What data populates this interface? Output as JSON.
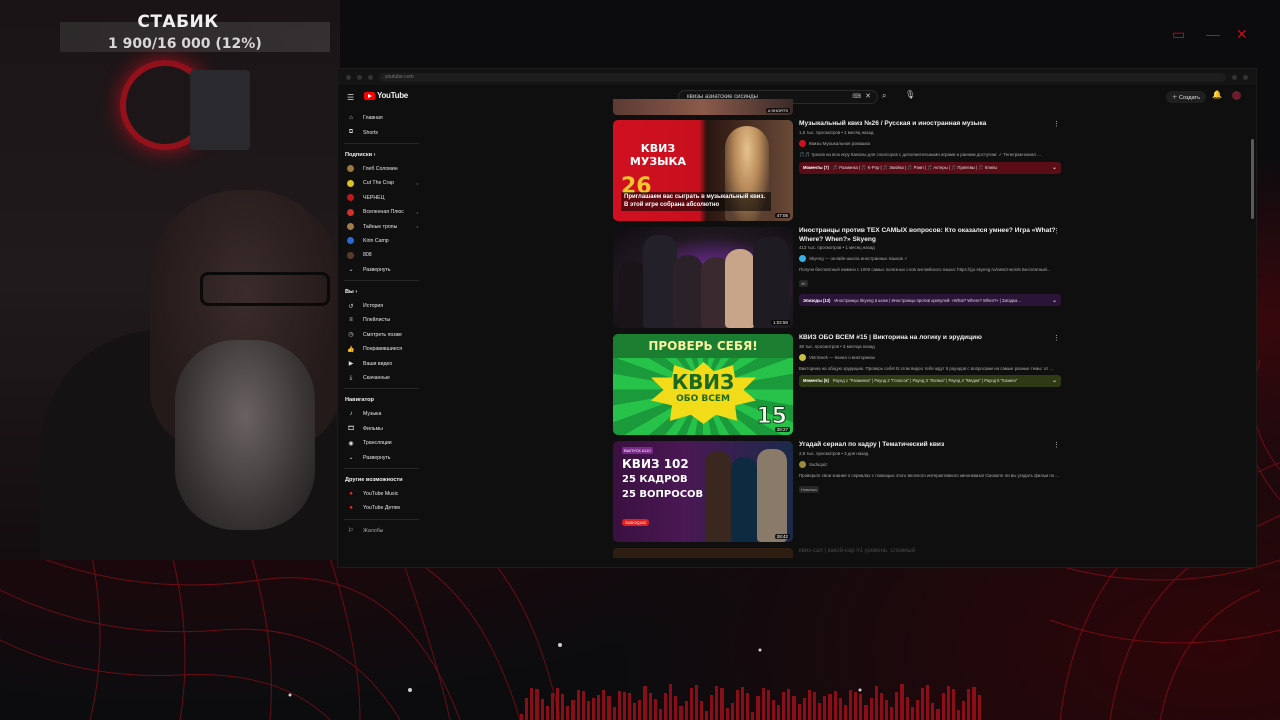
{
  "overlay": {
    "stat_title": "СТАБИК",
    "stat_value": "1 900/16 000 (12%)"
  },
  "browser": {
    "url": "youtube.com"
  },
  "youtube": {
    "logo": "YouTube",
    "search_query": "квизы азиатские сисинды",
    "create_label": "Создать"
  },
  "sidebar": {
    "main": [
      {
        "label": "Главная",
        "icon": "home-icon"
      },
      {
        "label": "Shorts",
        "icon": "shorts-icon"
      }
    ],
    "subs_header": "Подписки",
    "subs": [
      {
        "label": "Глеб Соломин",
        "color": "#9a7a3a",
        "live": ""
      },
      {
        "label": "Cut The Crap",
        "color": "#e0c020",
        "live": "•"
      },
      {
        "label": "ЧЕРНЕЦ",
        "color": "#c01818",
        "live": ""
      },
      {
        "label": "Вселенная Плюс",
        "color": "#d23030",
        "live": "•"
      },
      {
        "label": "Тайные тропы",
        "color": "#a07a50",
        "live": "•"
      },
      {
        "label": "Kirin Camp",
        "color": "#2a6ad0",
        "live": ""
      },
      {
        "label": "808",
        "color": "#5a3a2a",
        "live": ""
      }
    ],
    "subs_expand": "Развернуть",
    "you_header": "Вы",
    "you": [
      {
        "label": "История",
        "icon": "history-icon"
      },
      {
        "label": "Плейлисты",
        "icon": "playlists-icon"
      },
      {
        "label": "Смотреть позже",
        "icon": "watch-later-icon"
      },
      {
        "label": "Понравившиеся",
        "icon": "like-icon"
      },
      {
        "label": "Ваши видео",
        "icon": "your-videos-icon"
      },
      {
        "label": "Скачанные",
        "icon": "download-icon"
      }
    ],
    "nav_header": "Навигатор",
    "nav": [
      {
        "label": "Музыка",
        "icon": "music-icon"
      },
      {
        "label": "Фильмы",
        "icon": "films-icon"
      },
      {
        "label": "Трансляции",
        "icon": "live-icon"
      },
      {
        "label": "Развернуть",
        "icon": "chevron-down-icon"
      }
    ],
    "more_header": "Другие возможности",
    "more": [
      {
        "label": "YouTube Music",
        "icon": "yt-music-icon"
      },
      {
        "label": "YouTube Детям",
        "icon": "yt-kids-icon"
      }
    ],
    "report": "Жалобы"
  },
  "results": {
    "top_badge": "# SHORTS",
    "videos": [
      {
        "title": "Музыкальный квиз №26 / Русская и иностранная музыка",
        "meta": "1,5 тыс. просмотров • 1 месяц назад",
        "channel": "Квизы Музыкальная ромашка",
        "desc": "🎵🎵 треков на всю игру Каналы для спонсоров с дополнительными играми и ранним доступом: ✓ Телеграм-канал ...",
        "duration": "47:06",
        "thumb_line1": "КВИЗ",
        "thumb_line2": "МУЗЫКА",
        "thumb_num": "26",
        "thumb_caption": "Приглашаем вас сыграть в музыкальный квиз. В этой игре собрана абсолютно",
        "chapters_label": "Моменты (7)",
        "chapters": "🎵 Разминка | 🎵 K-Pop | 🎵 Эмойка | 🎵 Рэмп | 🎵 Актеры | 🎵 Припевы | 🎵 Клипы"
      },
      {
        "title": "Иностранцы против ТЕХ САМЫХ вопросов: Кто оказался умнее? Игра «What? Where? When?» Skyeng",
        "meta": "413 тыс. просмотров • 1 месяц назад",
        "channel": "Skyeng — онлайн-школа иностранных языков ✓",
        "desc": "Получи бесплатный коммиз с 1000 самых полезных слов английского языка: https://go.skyeng.ru/vww3-words Бесплатный...",
        "tag": "4K",
        "duration": "1:02:50",
        "chapters_label": "Эпизоды (13)",
        "chapters": "Иностранцы Skyeng в шоке | Иностранцы против хрипулей: «What? Where? When?» | Загадка..."
      },
      {
        "title": "КВИЗ ОБО ВСЕМ #15 | Викторина на логику и эрудицию",
        "meta": "38 тыс. просмотров • 3 месяца назад",
        "channel": "VkInSeek — Канал о викторинах",
        "desc": "Викторина на общую эрудицию. Проверь себя! В этом видео тебя ждут 5 раундов с вопросами на самые разные темы: от ...",
        "duration": "38:27",
        "thumb_top": "ПРОВЕРЬ СЕБЯ!",
        "thumb_kviz": "КВИЗ",
        "thumb_sub": "ОБО ВСЕМ",
        "thumb_num": "15",
        "chapters_label": "Моменты (5)",
        "chapters": "Раунд 1 \"Разминка\" | Раунд 2 \"Голосок\" | Раунд 3 \"Логика\" | Раунд 4 \"Медиа\" | Раунд 5 \"Казино\""
      },
      {
        "title": "Угадай сериал по кадру | Тематический квиз",
        "meta": "2,9 тыс. просмотров • 3 дня назад",
        "channel": "Sudoquiz",
        "desc": "Проверьте свои знания о сериалах с помощью этого веселого интерактивного кинонквиза! Сможете ли вы угадать фильм по ...",
        "tag": "Новинка",
        "duration": "28:42",
        "thumb_episode": "ВЫПУСК #110",
        "thumb_l1": "КВИЗ 102",
        "thumb_l2": "25 КАДРОВ",
        "thumb_l3": "25 ВОПРОСОВ",
        "thumb_pill": "SUDOQUIZ"
      }
    ],
    "ghost_title": "квиз-сал | какой-кар #1 уровень: сложный"
  }
}
